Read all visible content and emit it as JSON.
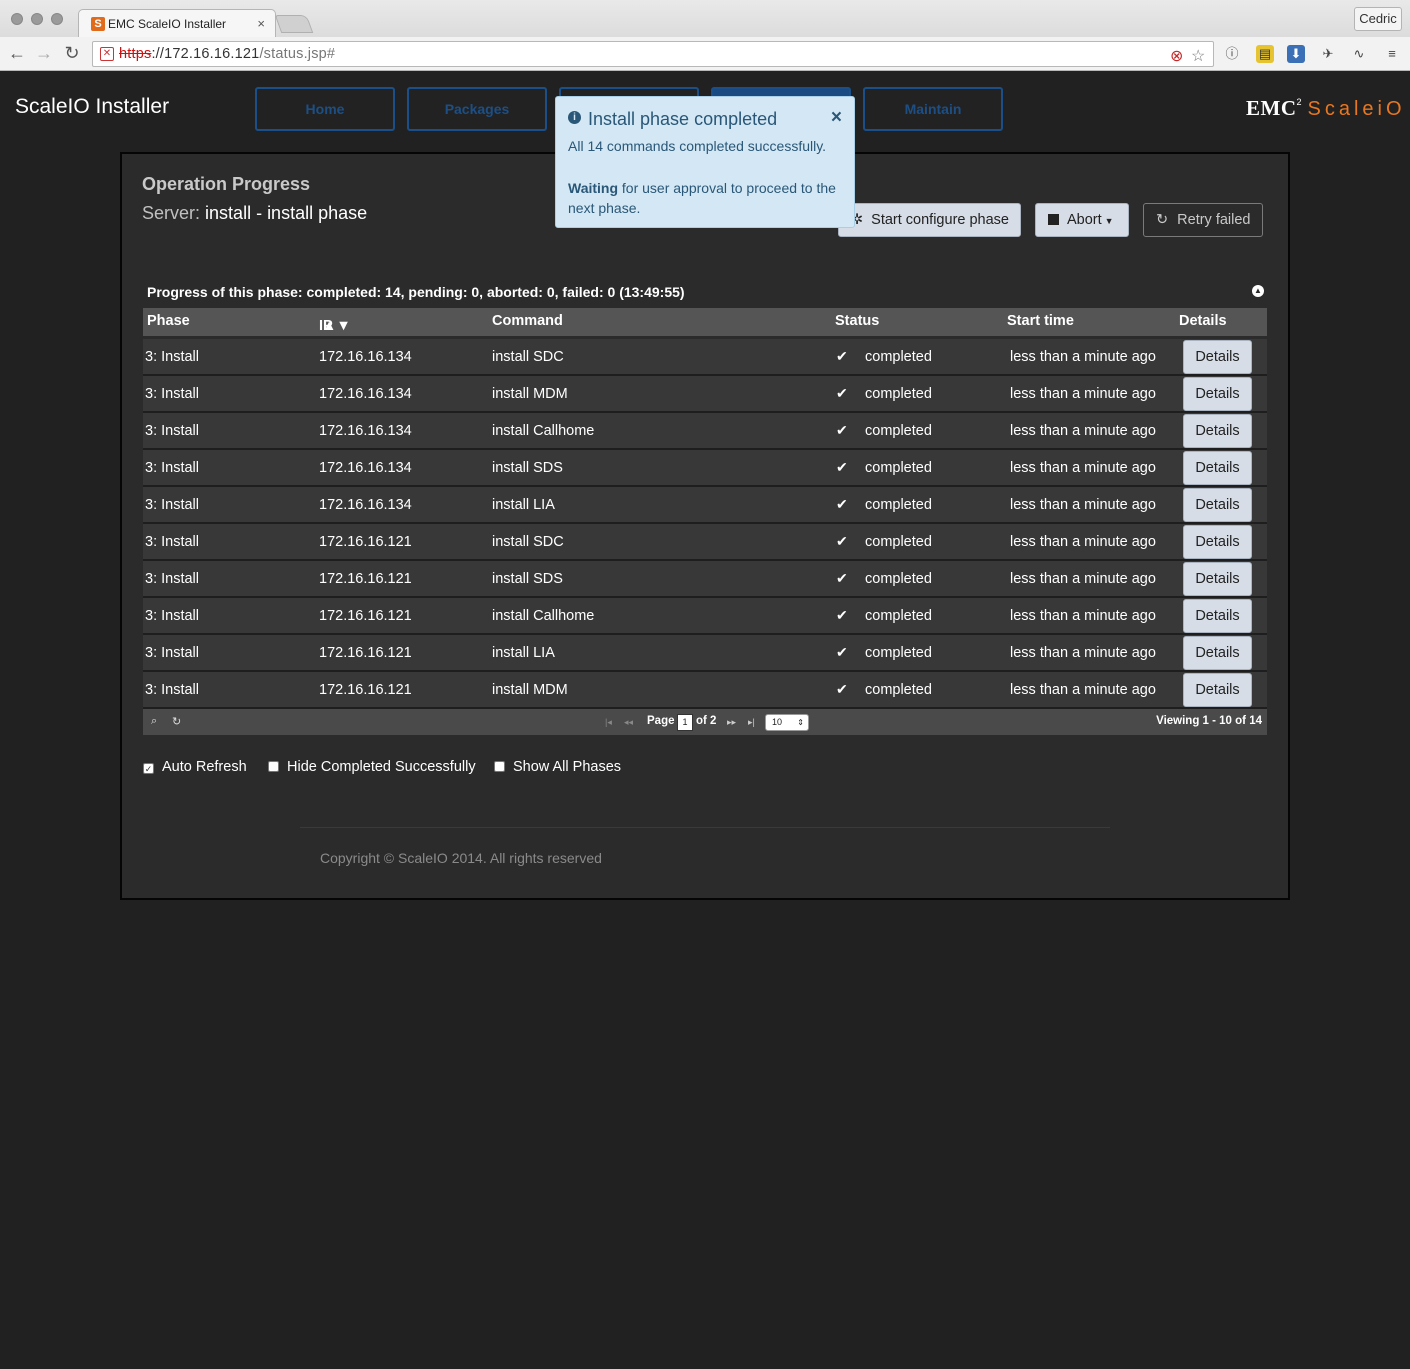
{
  "browser": {
    "tab_title": "EMC ScaleIO Installer",
    "tab_favicon_letter": "S",
    "tab_close": "×",
    "profile": "Cedric",
    "url_scheme": "https",
    "url_host": "://172.16.16.121",
    "url_path": "/status.jsp#"
  },
  "header": {
    "app_title": "ScaleIO Installer",
    "nav": [
      "Home",
      "Packages",
      "",
      "",
      "Maintain"
    ],
    "brand_emc": "EMC",
    "brand_sup": "2",
    "brand_scaleio": "ScaleiO"
  },
  "operation": {
    "title": "Operation Progress",
    "server_label": "Server:",
    "server_value": "install - install phase"
  },
  "actions": {
    "start_configure": "Start configure phase",
    "abort": "Abort",
    "retry_failed": "Retry failed"
  },
  "alert": {
    "title": "Install phase completed",
    "close": "×",
    "message": "All 14 commands completed successfully.",
    "waiting_bold": "Waiting",
    "waiting_rest": " for user approval to proceed to the next phase."
  },
  "progress": {
    "summary": "Progress of this phase: completed: 14, pending: 0, aborted: 0, failed: 0 (13:49:55)"
  },
  "table": {
    "columns": [
      "Phase",
      "IP",
      "Command",
      "Status",
      "Start time",
      "Details"
    ],
    "rows": [
      {
        "phase": "3: Install",
        "ip": "172.16.16.134",
        "command": "install SDC",
        "status": "completed",
        "start": "less than a minute ago",
        "details": "Details"
      },
      {
        "phase": "3: Install",
        "ip": "172.16.16.134",
        "command": "install MDM",
        "status": "completed",
        "start": "less than a minute ago",
        "details": "Details"
      },
      {
        "phase": "3: Install",
        "ip": "172.16.16.134",
        "command": "install Callhome",
        "status": "completed",
        "start": "less than a minute ago",
        "details": "Details"
      },
      {
        "phase": "3: Install",
        "ip": "172.16.16.134",
        "command": "install SDS",
        "status": "completed",
        "start": "less than a minute ago",
        "details": "Details"
      },
      {
        "phase": "3: Install",
        "ip": "172.16.16.134",
        "command": "install LIA",
        "status": "completed",
        "start": "less than a minute ago",
        "details": "Details"
      },
      {
        "phase": "3: Install",
        "ip": "172.16.16.121",
        "command": "install SDC",
        "status": "completed",
        "start": "less than a minute ago",
        "details": "Details"
      },
      {
        "phase": "3: Install",
        "ip": "172.16.16.121",
        "command": "install SDS",
        "status": "completed",
        "start": "less than a minute ago",
        "details": "Details"
      },
      {
        "phase": "3: Install",
        "ip": "172.16.16.121",
        "command": "install Callhome",
        "status": "completed",
        "start": "less than a minute ago",
        "details": "Details"
      },
      {
        "phase": "3: Install",
        "ip": "172.16.16.121",
        "command": "install LIA",
        "status": "completed",
        "start": "less than a minute ago",
        "details": "Details"
      },
      {
        "phase": "3: Install",
        "ip": "172.16.16.121",
        "command": "install MDM",
        "status": "completed",
        "start": "less than a minute ago",
        "details": "Details"
      }
    ]
  },
  "pager": {
    "page_label": "Page",
    "page_value": "1",
    "of_label": "of 2",
    "rows_per_page": "10",
    "viewing": "Viewing 1 - 10 of 14"
  },
  "options": {
    "auto_refresh": "Auto Refresh",
    "hide_completed": "Hide Completed Successfully",
    "show_all": "Show All Phases"
  },
  "footer": {
    "copyright": "Copyright © ScaleIO 2014. All rights reserved"
  }
}
